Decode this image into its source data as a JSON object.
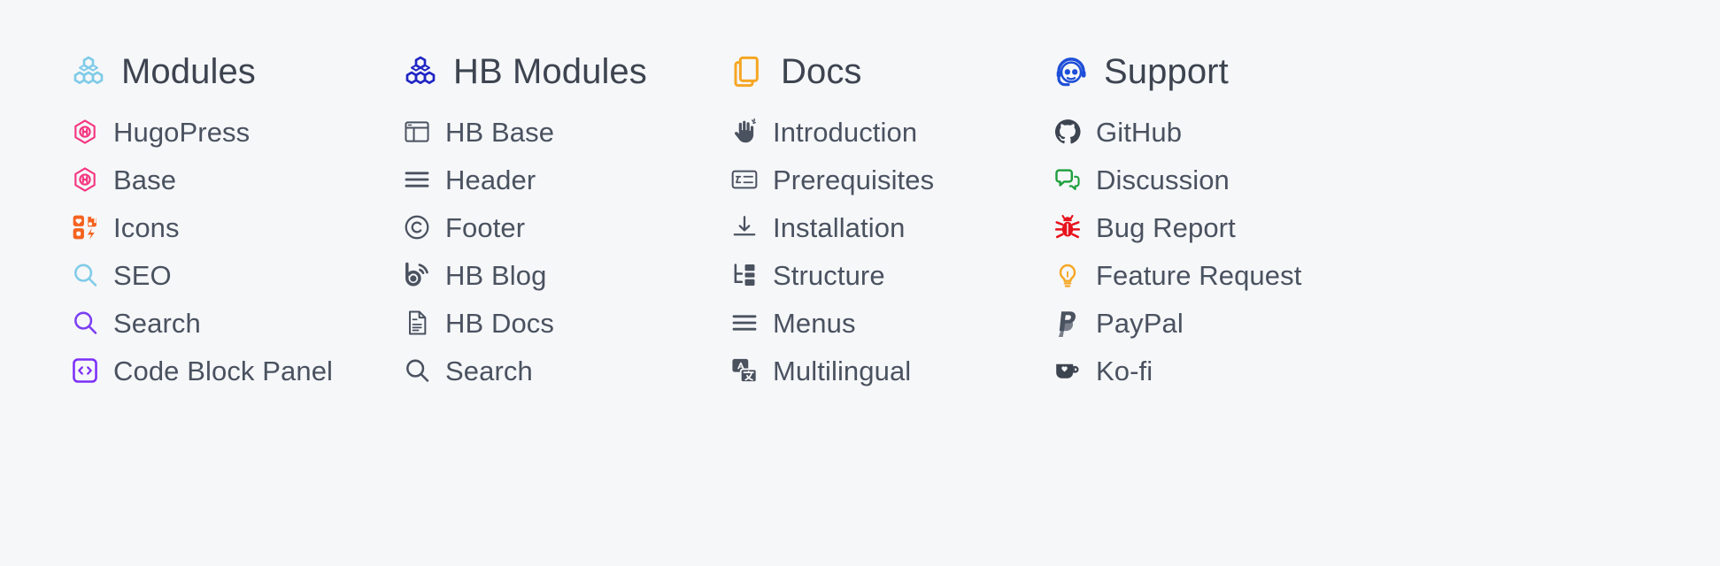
{
  "page": {
    "background_color": "#f6f7f9",
    "heading_text_color": "#3d4450",
    "link_text_color": "#4a5260"
  },
  "columns": [
    {
      "heading": {
        "label": "Modules",
        "icon": "cubes-icon",
        "icon_color": "#7fcbe8"
      },
      "links": [
        {
          "label": "HugoPress",
          "icon": "hexagon-h-icon",
          "icon_color": "#f4347f"
        },
        {
          "label": "Base",
          "icon": "hexagon-h-icon",
          "icon_color": "#f4347f"
        },
        {
          "label": "Icons",
          "icon": "icon-grid-icon",
          "icon_color": "#f4621f"
        },
        {
          "label": "SEO",
          "icon": "magnifier-icon",
          "icon_color": "#7fcbe8"
        },
        {
          "label": "Search",
          "icon": "magnifier-icon",
          "icon_color": "#7b3ff2"
        },
        {
          "label": "Code Block Panel",
          "icon": "code-block-icon",
          "icon_color": "#7b2ff7"
        }
      ]
    },
    {
      "heading": {
        "label": "HB Modules",
        "icon": "cubes-icon",
        "icon_color": "#1f25c4"
      },
      "links": [
        {
          "label": "HB Base",
          "icon": "layout-panel-icon",
          "icon_color": "#4a5260"
        },
        {
          "label": "Header",
          "icon": "hamburger-icon",
          "icon_color": "#4a5260"
        },
        {
          "label": "Footer",
          "icon": "copyright-icon",
          "icon_color": "#4a5260"
        },
        {
          "label": "HB Blog",
          "icon": "rss-blog-icon",
          "icon_color": "#4a5260"
        },
        {
          "label": "HB Docs",
          "icon": "document-icon",
          "icon_color": "#4a5260"
        },
        {
          "label": "Search",
          "icon": "magnifier-icon",
          "icon_color": "#4a5260"
        }
      ]
    },
    {
      "heading": {
        "label": "Docs",
        "icon": "books-stack-icon",
        "icon_color": "#f5a623"
      },
      "links": [
        {
          "label": "Introduction",
          "icon": "waving-hand-icon",
          "icon_color": "#4a5260"
        },
        {
          "label": "Prerequisites",
          "icon": "checklist-icon",
          "icon_color": "#4a5260"
        },
        {
          "label": "Installation",
          "icon": "download-icon",
          "icon_color": "#4a5260"
        },
        {
          "label": "Structure",
          "icon": "tree-nodes-icon",
          "icon_color": "#4a5260"
        },
        {
          "label": "Menus",
          "icon": "hamburger-icon",
          "icon_color": "#4a5260"
        },
        {
          "label": "Multilingual",
          "icon": "translate-icon",
          "icon_color": "#4a5260"
        }
      ]
    },
    {
      "heading": {
        "label": "Support",
        "icon": "headset-icon",
        "icon_color": "#1d4ed8"
      },
      "links": [
        {
          "label": "GitHub",
          "icon": "github-icon",
          "icon_color": "#3c4450"
        },
        {
          "label": "Discussion",
          "icon": "chat-bubbles-icon",
          "icon_color": "#1d9e3c"
        },
        {
          "label": "Bug Report",
          "icon": "bug-icon",
          "icon_color": "#e8121c"
        },
        {
          "label": "Feature Request",
          "icon": "lightbulb-icon",
          "icon_color": "#f5a623"
        },
        {
          "label": "PayPal",
          "icon": "paypal-icon",
          "icon_color": "#4a5260"
        },
        {
          "label": "Ko-fi",
          "icon": "kofi-cup-icon",
          "icon_color": "#3c4450"
        }
      ]
    }
  ]
}
